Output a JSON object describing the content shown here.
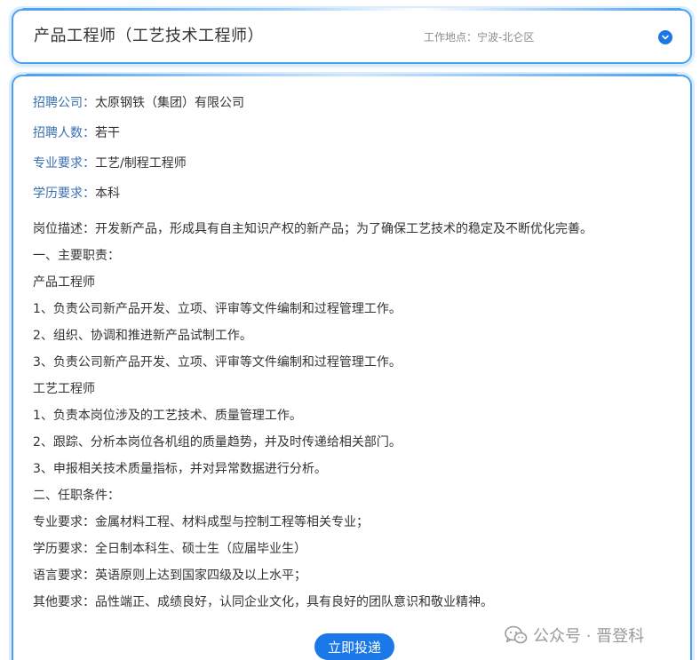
{
  "header": {
    "job_title": "产品工程师（工艺技术工程师）",
    "location": "工作地点：宁波-北仑区"
  },
  "info": {
    "company_label": "招聘公司：",
    "company_value": "太原钢铁（集团）有限公司",
    "headcount_label": "招聘人数：",
    "headcount_value": "若干",
    "major_label": "专业要求：",
    "major_value": "工艺/制程工程师",
    "education_label": "学历要求：",
    "education_value": "本科"
  },
  "description": [
    "岗位描述：开发新产品，形成具有自主知识产权的新产品；为了确保工艺技术的稳定及不断优化完善。",
    "一、主要职责：",
    "产品工程师",
    "1、负责公司新产品开发、立项、评审等文件编制和过程管理工作。",
    "2、组织、协调和推进新产品试制工作。",
    "3、负责公司新产品开发、立项、评审等文件编制和过程管理工作。",
    "工艺工程师",
    "1、负责本岗位涉及的工艺技术、质量管理工作。",
    "2、跟踪、分析本岗位各机组的质量趋势，并及时传递给相关部门。",
    "3、申报相关技术质量指标，并对异常数据进行分析。",
    "二、任职条件：",
    "专业要求：金属材料工程、材料成型与控制工程等相关专业；",
    "学历要求：全日制本科生、硕士生（应届毕业生）",
    "语言要求：英语原则上达到国家四级及以上水平；",
    "其他要求：品性端正、成绩良好，认同企业文化，具有良好的团队意识和敬业精神。"
  ],
  "apply_button": "立即投递",
  "watermark": {
    "text": "公众号 · 晋登科",
    "icon": "wechat-icon"
  },
  "colors": {
    "accent": "#1a78e8",
    "border": "#4aa0f2",
    "label": "#3a6fb0",
    "text": "#333333",
    "muted": "#8a8a8a"
  }
}
